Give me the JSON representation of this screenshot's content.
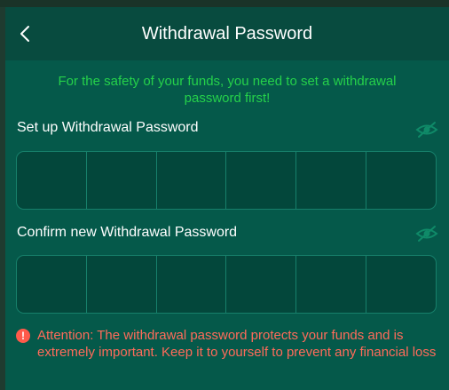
{
  "header": {
    "title": "Withdrawal Password",
    "back_icon": "chevron-left-icon"
  },
  "notice": "For the safety of your funds, you need to set a withdrawal password first!",
  "setup": {
    "label": "Set up Withdrawal Password",
    "visibility_icon": "eye-off-icon",
    "digits": 6
  },
  "confirm": {
    "label": "Confirm new Withdrawal Password",
    "visibility_icon": "eye-off-icon",
    "digits": 6
  },
  "attention": {
    "icon": "exclamation-icon",
    "icon_glyph": "!",
    "text": "Attention: The withdrawal password protects your funds and is extremely important. Keep it to yourself to prevent any financial loss"
  },
  "colors": {
    "background": "#05594a",
    "header": "#084b3f",
    "notice": "#25d14a",
    "warning": "#ff6b5a",
    "input_border": "#17806b"
  }
}
